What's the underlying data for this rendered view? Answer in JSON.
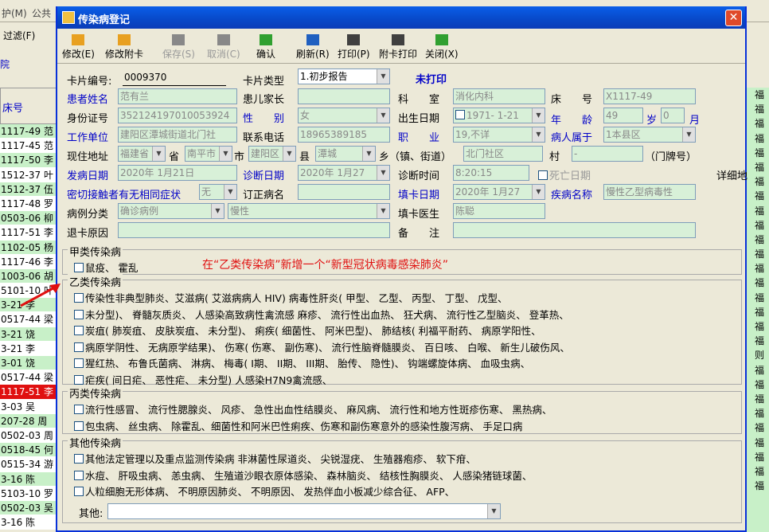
{
  "background": {
    "menu": [
      "护(M)",
      "公共"
    ],
    "filter_label": "过滤(F)",
    "hospital_label": "院",
    "grid_header": "床号",
    "rows": [
      "1117-49 范",
      "1117-45 范",
      "1117-50 李",
      "1512-37 叶",
      "1512-37 伍",
      "1117-48 罗",
      "0503-06 柳",
      "1117-51 李",
      "1102-05 杨",
      "1117-46 李",
      "1003-06 胡",
      "5101-10 叶",
      "3-21 李",
      "0517-44 梁",
      "3-21 饶",
      "3-21 李",
      "3-01 饶",
      "0517-44 梁",
      "1117-51 李",
      "3-03 吴",
      "207-28 周",
      "0502-03 周",
      "0518-45 何",
      "0515-34 游",
      "3-16 陈",
      "5103-10 罗",
      "0502-03 吴",
      "3-16 陈"
    ],
    "right_col": [
      "福",
      "福",
      "福",
      "福",
      "福",
      "福",
      "福",
      "福",
      "福",
      "福",
      "福",
      "福",
      "福",
      "福",
      "福",
      "福",
      "福",
      "福",
      "则",
      "福",
      "福",
      "福",
      "福",
      "福",
      "福",
      "福",
      "福",
      "福"
    ]
  },
  "dialog": {
    "title": "传染病登记",
    "toolbar": [
      {
        "label": "修改(E)",
        "enabled": true
      },
      {
        "label": "修改附卡",
        "enabled": true
      },
      {
        "label": "保存(S)",
        "enabled": false
      },
      {
        "label": "取消(C)",
        "enabled": false
      },
      {
        "label": "确认",
        "enabled": true
      },
      {
        "label": "刷新(R)",
        "enabled": true
      },
      {
        "label": "打印(P)",
        "enabled": true
      },
      {
        "label": "附卡打印",
        "enabled": true
      },
      {
        "label": "关闭(X)",
        "enabled": true
      }
    ]
  },
  "form": {
    "card_no_label": "卡片编号:",
    "card_no": "0009370",
    "card_type_label": "卡片类型",
    "card_type": "1.初步报告",
    "print_status": "未打印",
    "patient_label": "患者姓名",
    "patient": "范有兰",
    "parent_label": "患儿家长",
    "parent": "",
    "dept_label": "科　　室",
    "dept": "消化内科",
    "bed_label": "床　　号",
    "bed": "X1117-49",
    "id_label": "身份证号",
    "id_no": "352124197010053924",
    "sex_label": "性　　别",
    "sex": "女",
    "birth_label": "出生日期",
    "birth": "1971- 1-21",
    "age_label": "年　　龄",
    "age": "49",
    "age_unit": "岁",
    "month": "0",
    "month_unit": "月",
    "work_label": "工作单位",
    "work": "建阳区潭城街道北门社",
    "phone_label": "联系电话",
    "phone": "18965389185",
    "job_label": "职　　业",
    "job": "19,不详",
    "belong_label": "病人属于",
    "belong": "1本县区",
    "addr_label": "现住地址",
    "province": "福建省",
    "sheng": "省",
    "city": "南平市",
    "shi": "市",
    "county": "建阳区",
    "xian": "县",
    "town": "潭城",
    "xiang": "乡（镇、街道）",
    "village": "北门社区",
    "cun": "村",
    "house": "-",
    "menpai": "（门牌号）",
    "onset_label": "发病日期",
    "onset": "2020年 1月21日",
    "diag_label": "诊断日期",
    "diag": "2020年 1月27",
    "diagtime_label": "诊断时间",
    "diagtime": "8:20:15",
    "death_label": "死亡日期",
    "detail": "详细地",
    "contact_label": "密切接触者有无相同症状",
    "contact": "无",
    "revise_label": "订正病名",
    "revise": "",
    "fill_date_label": "填卡日期",
    "fill_date": "2020年 1月27",
    "disease_label": "疾病名称",
    "disease": "慢性乙型病毒性",
    "case_class_label": "病例分类",
    "case_class": "确诊病例",
    "case_class2": "慢性",
    "doctor_label": "填卡医生",
    "doctor": "陈聪",
    "reject_label": "退卡原因",
    "reject": "",
    "remark_label": "备　　注",
    "remark": ""
  },
  "groups": {
    "a_title": "甲类传染病",
    "a_line": "鼠疫、 霍乱",
    "annotation": "在“乙类传染病”新增一个“新型冠状病毒感染肺炎”",
    "b_title": "乙类传染病",
    "b_lines": [
      "传染性非典型肺炎、艾滋病(  艾滋病病人  HIV)  病毒性肝炎(  甲型、  乙型、  丙型、  丁型、  戊型、",
      "未分型)、  脊髓灰质炎、  人感染高致病性禽流感   麻疹、  流行性出血热、  狂犬病、  流行性乙型脑炎、  登革热、",
      "炭疽(  肺炭疽、  皮肤炭疽、  未分型)、  痢疾(  细菌性、  阿米巴型)、  肺结核(  利福平耐药、  病原学阳性、",
      "病原学阴性、  无病原学结果)、  伤寒(  伤寒、  副伤寒)、  流行性脑脊髓膜炎、  百日咳、  白喉、  新生儿破伤风、",
      "猩红热、  布鲁氏菌病、  淋病、  梅毒(  I期、  II期、  III期、  胎传、  隐性)、  钩端螺旋体病、  血吸虫病、",
      "疟疾(  间日疟、  恶性疟、  未分型)   人感染H7N9禽流感、"
    ],
    "c_title": "丙类传染病",
    "c_lines": [
      "流行性感冒、  流行性腮腺炎、  风疹、  急性出血性结膜炎、  麻风病、  流行性和地方性斑疹伤寒、  黑热病、",
      "包虫病、  丝虫病、  除霍乱、细菌性和阿米巴性痢疾、伤寒和副伤寒意外的感染性腹泻病、  手足口病"
    ],
    "d_title": "其他传染病",
    "d_lines": [
      "其他法定管理以及重点监测传染病  非淋菌性尿道炎、  尖锐湿疣、  生殖器疱疹、                    软下疳、",
      "水痘、  肝吸虫病、  恙虫病、  生殖道沙眼衣原体感染、  森林脑炎、  结核性胸膜炎、  人感染猪链球菌、",
      "人粒细胞无形体病、  不明原因肺炎、  不明原因、  发热伴血小板减少综合征、  AFP、"
    ],
    "other_label": "其他:",
    "other": ""
  }
}
